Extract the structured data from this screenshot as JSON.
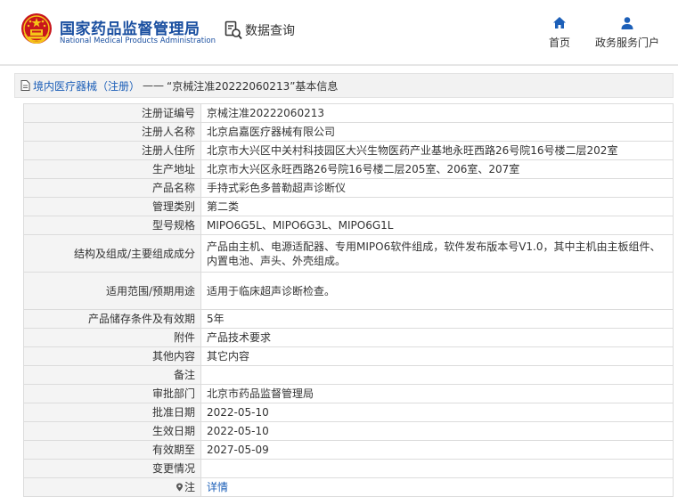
{
  "header": {
    "brand_cn": "国家药品监督管理局",
    "brand_en": "National Medical Products Administration",
    "data_query": "数据查询",
    "nav": [
      {
        "label": "首页",
        "icon": "home-icon"
      },
      {
        "label": "政务服务门户",
        "icon": "user-icon"
      }
    ],
    "colors": {
      "brand": "#1a4fa0",
      "emblem_red": "#c8161d",
      "emblem_gold": "#f5c518",
      "link": "#1c5fb8"
    }
  },
  "breadcrumb": {
    "category": "境内医疗器械（注册）",
    "separator": "——",
    "current": "“京械注准20222060213”基本信息"
  },
  "rows": [
    {
      "label": "注册证编号",
      "value": "京械注准20222060213"
    },
    {
      "label": "注册人名称",
      "value": "北京启嘉医疗器械有限公司"
    },
    {
      "label": "注册人住所",
      "value": "北京市大兴区中关村科技园区大兴生物医药产业基地永旺西路26号院16号楼二层202室"
    },
    {
      "label": "生产地址",
      "value": "北京市大兴区永旺西路26号院16号楼二层205室、206室、207室"
    },
    {
      "label": "产品名称",
      "value": "手持式彩色多普勒超声诊断仪"
    },
    {
      "label": "管理类别",
      "value": "第二类"
    },
    {
      "label": "型号规格",
      "value": "MIPO6G5L、MIPO6G3L、MIPO6G1L"
    },
    {
      "label": "结构及组成/主要组成成分",
      "value": "产品由主机、电源适配器、专用MIPO6软件组成，软件发布版本号V1.0，其中主机由主板组件、内置电池、声头、外壳组成。"
    },
    {
      "label": "适用范围/预期用途",
      "value": "适用于临床超声诊断检查。"
    },
    {
      "label": "产品储存条件及有效期",
      "value": "5年"
    },
    {
      "label": "附件",
      "value": "产品技术要求"
    },
    {
      "label": "其他内容",
      "value": "其它内容"
    },
    {
      "label": "备注",
      "value": ""
    },
    {
      "label": "审批部门",
      "value": "北京市药品监督管理局"
    },
    {
      "label": "批准日期",
      "value": "2022-05-10"
    },
    {
      "label": "生效日期",
      "value": "2022-05-10"
    },
    {
      "label": "有效期至",
      "value": "2027-05-09"
    },
    {
      "label": "变更情况",
      "value": ""
    }
  ],
  "note_row": {
    "label": "注",
    "icon": "location-pin-icon",
    "value": "详情"
  }
}
